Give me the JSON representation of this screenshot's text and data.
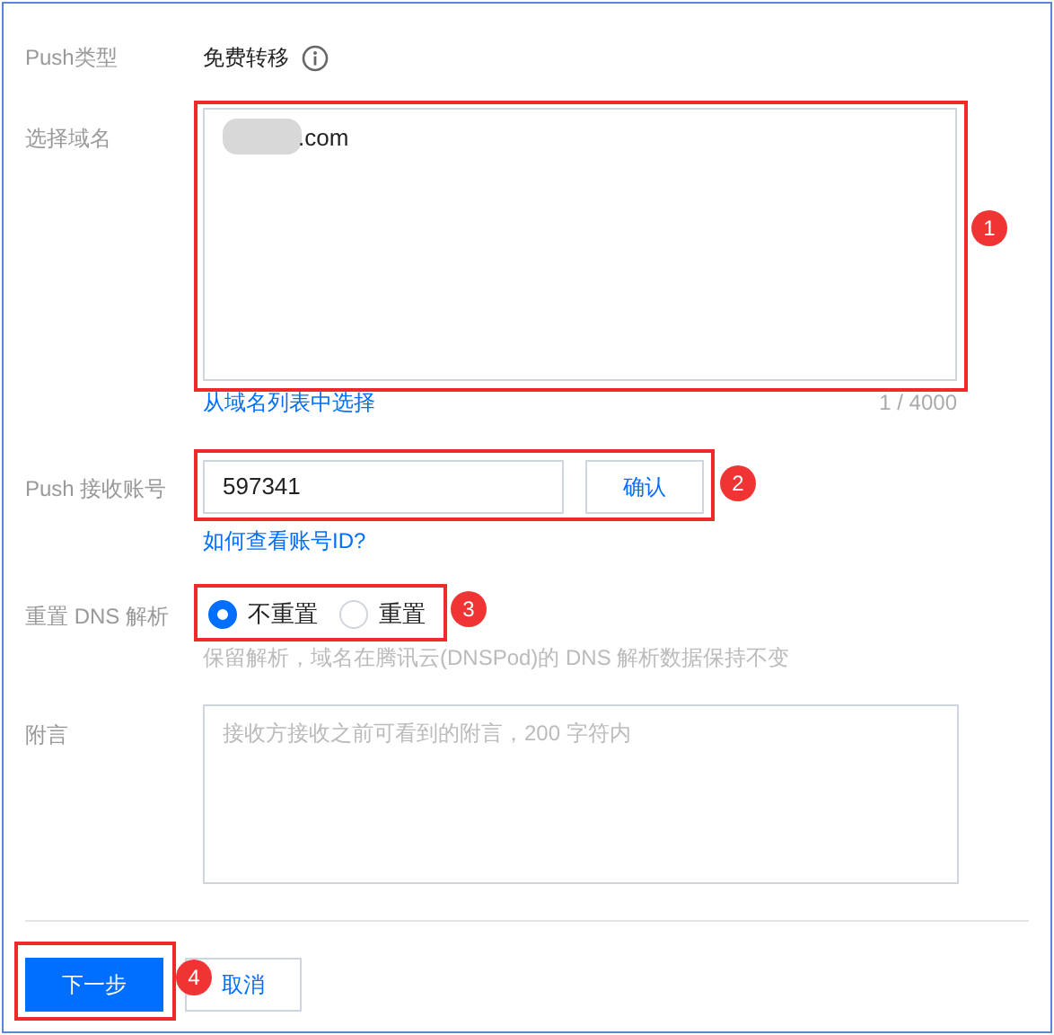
{
  "push_type": {
    "label": "Push类型",
    "value": "免费转移"
  },
  "domain": {
    "label": "选择域名",
    "value": ".com",
    "link": "从域名列表中选择",
    "counter": "1 / 4000"
  },
  "account": {
    "label": "Push 接收账号",
    "value": "597341",
    "confirm": "确认",
    "link": "如何查看账号ID?"
  },
  "dns": {
    "label": "重置 DNS 解析",
    "options": [
      {
        "label": "不重置",
        "selected": true
      },
      {
        "label": "重置",
        "selected": false
      }
    ],
    "hint": "保留解析，域名在腾讯云(DNSPod)的 DNS 解析数据保持不变"
  },
  "note": {
    "label": "附言",
    "placeholder": "接收方接收之前可看到的附言，200 字符内"
  },
  "buttons": [
    {
      "label": "下一步",
      "kind": "primary"
    },
    {
      "label": "取消",
      "kind": "secondary"
    }
  ],
  "annotations": [
    "1",
    "2",
    "3",
    "4"
  ]
}
